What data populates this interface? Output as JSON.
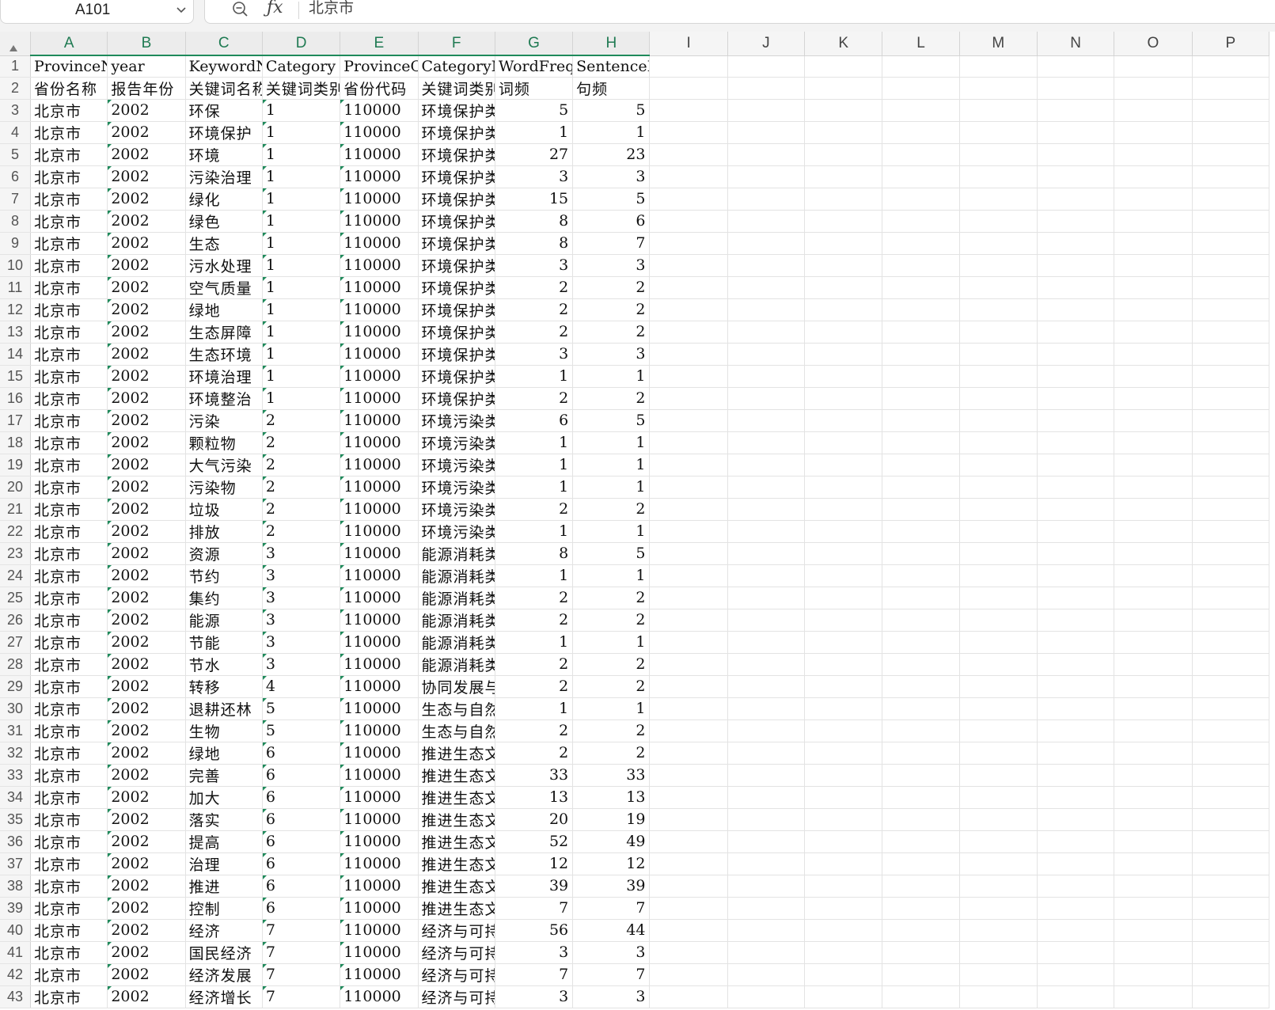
{
  "name_box": {
    "value": "A101"
  },
  "formula_bar": {
    "value": "北京市"
  },
  "columns": [
    "A",
    "B",
    "C",
    "D",
    "E",
    "F",
    "G",
    "H",
    "I",
    "J",
    "K",
    "L",
    "M",
    "N",
    "O",
    "P"
  ],
  "rows": [
    {
      "n": "1",
      "c": [
        "ProvinceN",
        "year",
        "KeywordNa",
        "Category",
        "ProvinceC",
        "CategoryN",
        "WordFrequ",
        "SentenceFrequency"
      ]
    },
    {
      "n": "2",
      "c": [
        "省份名称",
        "报告年份",
        "关键词名称",
        "关键词类别",
        "省份代码",
        "关键词类别",
        "词频",
        "句频"
      ]
    },
    {
      "n": "3",
      "c": [
        "北京市",
        "2002",
        "环保",
        "1",
        "110000",
        "环境保护类",
        "5",
        "5"
      ]
    },
    {
      "n": "4",
      "c": [
        "北京市",
        "2002",
        "环境保护",
        "1",
        "110000",
        "环境保护类",
        "1",
        "1"
      ]
    },
    {
      "n": "5",
      "c": [
        "北京市",
        "2002",
        "环境",
        "1",
        "110000",
        "环境保护类",
        "27",
        "23"
      ]
    },
    {
      "n": "6",
      "c": [
        "北京市",
        "2002",
        "污染治理",
        "1",
        "110000",
        "环境保护类",
        "3",
        "3"
      ]
    },
    {
      "n": "7",
      "c": [
        "北京市",
        "2002",
        "绿化",
        "1",
        "110000",
        "环境保护类",
        "15",
        "5"
      ]
    },
    {
      "n": "8",
      "c": [
        "北京市",
        "2002",
        "绿色",
        "1",
        "110000",
        "环境保护类",
        "8",
        "6"
      ]
    },
    {
      "n": "9",
      "c": [
        "北京市",
        "2002",
        "生态",
        "1",
        "110000",
        "环境保护类",
        "8",
        "7"
      ]
    },
    {
      "n": "10",
      "c": [
        "北京市",
        "2002",
        "污水处理",
        "1",
        "110000",
        "环境保护类",
        "3",
        "3"
      ]
    },
    {
      "n": "11",
      "c": [
        "北京市",
        "2002",
        "空气质量",
        "1",
        "110000",
        "环境保护类",
        "2",
        "2"
      ]
    },
    {
      "n": "12",
      "c": [
        "北京市",
        "2002",
        "绿地",
        "1",
        "110000",
        "环境保护类",
        "2",
        "2"
      ]
    },
    {
      "n": "13",
      "c": [
        "北京市",
        "2002",
        "生态屏障",
        "1",
        "110000",
        "环境保护类",
        "2",
        "2"
      ]
    },
    {
      "n": "14",
      "c": [
        "北京市",
        "2002",
        "生态环境",
        "1",
        "110000",
        "环境保护类",
        "3",
        "3"
      ]
    },
    {
      "n": "15",
      "c": [
        "北京市",
        "2002",
        "环境治理",
        "1",
        "110000",
        "环境保护类",
        "1",
        "1"
      ]
    },
    {
      "n": "16",
      "c": [
        "北京市",
        "2002",
        "环境整治",
        "1",
        "110000",
        "环境保护类",
        "2",
        "2"
      ]
    },
    {
      "n": "17",
      "c": [
        "北京市",
        "2002",
        "污染",
        "2",
        "110000",
        "环境污染类",
        "6",
        "5"
      ]
    },
    {
      "n": "18",
      "c": [
        "北京市",
        "2002",
        "颗粒物",
        "2",
        "110000",
        "环境污染类",
        "1",
        "1"
      ]
    },
    {
      "n": "19",
      "c": [
        "北京市",
        "2002",
        "大气污染",
        "2",
        "110000",
        "环境污染类",
        "1",
        "1"
      ]
    },
    {
      "n": "20",
      "c": [
        "北京市",
        "2002",
        "污染物",
        "2",
        "110000",
        "环境污染类",
        "1",
        "1"
      ]
    },
    {
      "n": "21",
      "c": [
        "北京市",
        "2002",
        "垃圾",
        "2",
        "110000",
        "环境污染类",
        "2",
        "2"
      ]
    },
    {
      "n": "22",
      "c": [
        "北京市",
        "2002",
        "排放",
        "2",
        "110000",
        "环境污染类",
        "1",
        "1"
      ]
    },
    {
      "n": "23",
      "c": [
        "北京市",
        "2002",
        "资源",
        "3",
        "110000",
        "能源消耗类",
        "8",
        "5"
      ]
    },
    {
      "n": "24",
      "c": [
        "北京市",
        "2002",
        "节约",
        "3",
        "110000",
        "能源消耗类",
        "1",
        "1"
      ]
    },
    {
      "n": "25",
      "c": [
        "北京市",
        "2002",
        "集约",
        "3",
        "110000",
        "能源消耗类",
        "2",
        "2"
      ]
    },
    {
      "n": "26",
      "c": [
        "北京市",
        "2002",
        "能源",
        "3",
        "110000",
        "能源消耗类",
        "2",
        "2"
      ]
    },
    {
      "n": "27",
      "c": [
        "北京市",
        "2002",
        "节能",
        "3",
        "110000",
        "能源消耗类",
        "1",
        "1"
      ]
    },
    {
      "n": "28",
      "c": [
        "北京市",
        "2002",
        "节水",
        "3",
        "110000",
        "能源消耗类",
        "2",
        "2"
      ]
    },
    {
      "n": "29",
      "c": [
        "北京市",
        "2002",
        "转移",
        "4",
        "110000",
        "协同发展与",
        "2",
        "2"
      ]
    },
    {
      "n": "30",
      "c": [
        "北京市",
        "2002",
        "退耕还林",
        "5",
        "110000",
        "生态与自然",
        "1",
        "1"
      ]
    },
    {
      "n": "31",
      "c": [
        "北京市",
        "2002",
        "生物",
        "5",
        "110000",
        "生态与自然",
        "2",
        "2"
      ]
    },
    {
      "n": "32",
      "c": [
        "北京市",
        "2002",
        "绿地",
        "6",
        "110000",
        "推进生态文",
        "2",
        "2"
      ]
    },
    {
      "n": "33",
      "c": [
        "北京市",
        "2002",
        "完善",
        "6",
        "110000",
        "推进生态文",
        "33",
        "33"
      ]
    },
    {
      "n": "34",
      "c": [
        "北京市",
        "2002",
        "加大",
        "6",
        "110000",
        "推进生态文",
        "13",
        "13"
      ]
    },
    {
      "n": "35",
      "c": [
        "北京市",
        "2002",
        "落实",
        "6",
        "110000",
        "推进生态文",
        "20",
        "19"
      ]
    },
    {
      "n": "36",
      "c": [
        "北京市",
        "2002",
        "提高",
        "6",
        "110000",
        "推进生态文",
        "52",
        "49"
      ]
    },
    {
      "n": "37",
      "c": [
        "北京市",
        "2002",
        "治理",
        "6",
        "110000",
        "推进生态文",
        "12",
        "12"
      ]
    },
    {
      "n": "38",
      "c": [
        "北京市",
        "2002",
        "推进",
        "6",
        "110000",
        "推进生态文",
        "39",
        "39"
      ]
    },
    {
      "n": "39",
      "c": [
        "北京市",
        "2002",
        "控制",
        "6",
        "110000",
        "推进生态文",
        "7",
        "7"
      ]
    },
    {
      "n": "40",
      "c": [
        "北京市",
        "2002",
        "经济",
        "7",
        "110000",
        "经济与可持",
        "56",
        "44"
      ]
    },
    {
      "n": "41",
      "c": [
        "北京市",
        "2002",
        "国民经济",
        "7",
        "110000",
        "经济与可持",
        "3",
        "3"
      ]
    },
    {
      "n": "42",
      "c": [
        "北京市",
        "2002",
        "经济发展",
        "7",
        "110000",
        "经济与可持",
        "7",
        "7"
      ]
    },
    {
      "n": "43",
      "c": [
        "北京市",
        "2002",
        "经济增长",
        "7",
        "110000",
        "经济与可持",
        "3",
        "3"
      ]
    }
  ]
}
